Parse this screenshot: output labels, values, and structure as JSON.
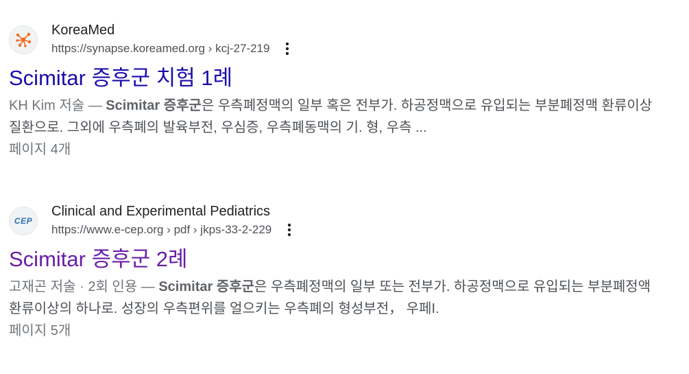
{
  "results": [
    {
      "site_name": "KoreaMed",
      "url": "https://synapse.koreamed.org › kcj-27-219",
      "favicon_icon": "koreamed-network-icon",
      "title": "Scimitar 증후군 치험 1례",
      "meta": "KH Kim 저술 — ",
      "snippet_bold": "Scimitar 증후군",
      "snippet_rest": "은 우측폐정맥의 일부 혹은 전부가. 하공정맥으로 유입되는 부분폐정맥 환류이상 질환으로. 그외에 우측폐의 발육부전, 우심증, 우측폐동맥의 기. 형, 우측 ...",
      "pages": "페이지 4개",
      "title_color": "#1a0dab"
    },
    {
      "site_name": "Clinical and Experimental Pediatrics",
      "url": "https://www.e-cep.org › pdf › jkps-33-2-229",
      "favicon_text": "CEP",
      "favicon_icon": "cep-logo-icon",
      "title": "Scimitar 증후군 2례",
      "meta": "고재곤 저술 · 2회 인용 — ",
      "snippet_bold": "Scimitar 증후군",
      "snippet_rest": "은 우측폐정맥의 일부 또는 전부가. 하공정맥으로 유입되는 부분폐정액 환류이상의 하나로. 성장의 우측편위를 얼으키는 우측폐의 형성부전， 우페I.",
      "pages": "페이지 5개",
      "title_color": "#681da8"
    }
  ],
  "icons": {
    "more": "more-vert-icon"
  },
  "colors": {
    "link_unvisited": "#1a0dab",
    "link_visited": "#681da8",
    "text_gray": "#4d5156",
    "koreamed_orange": "#f26b21",
    "cep_blue": "#2f6fb4"
  }
}
